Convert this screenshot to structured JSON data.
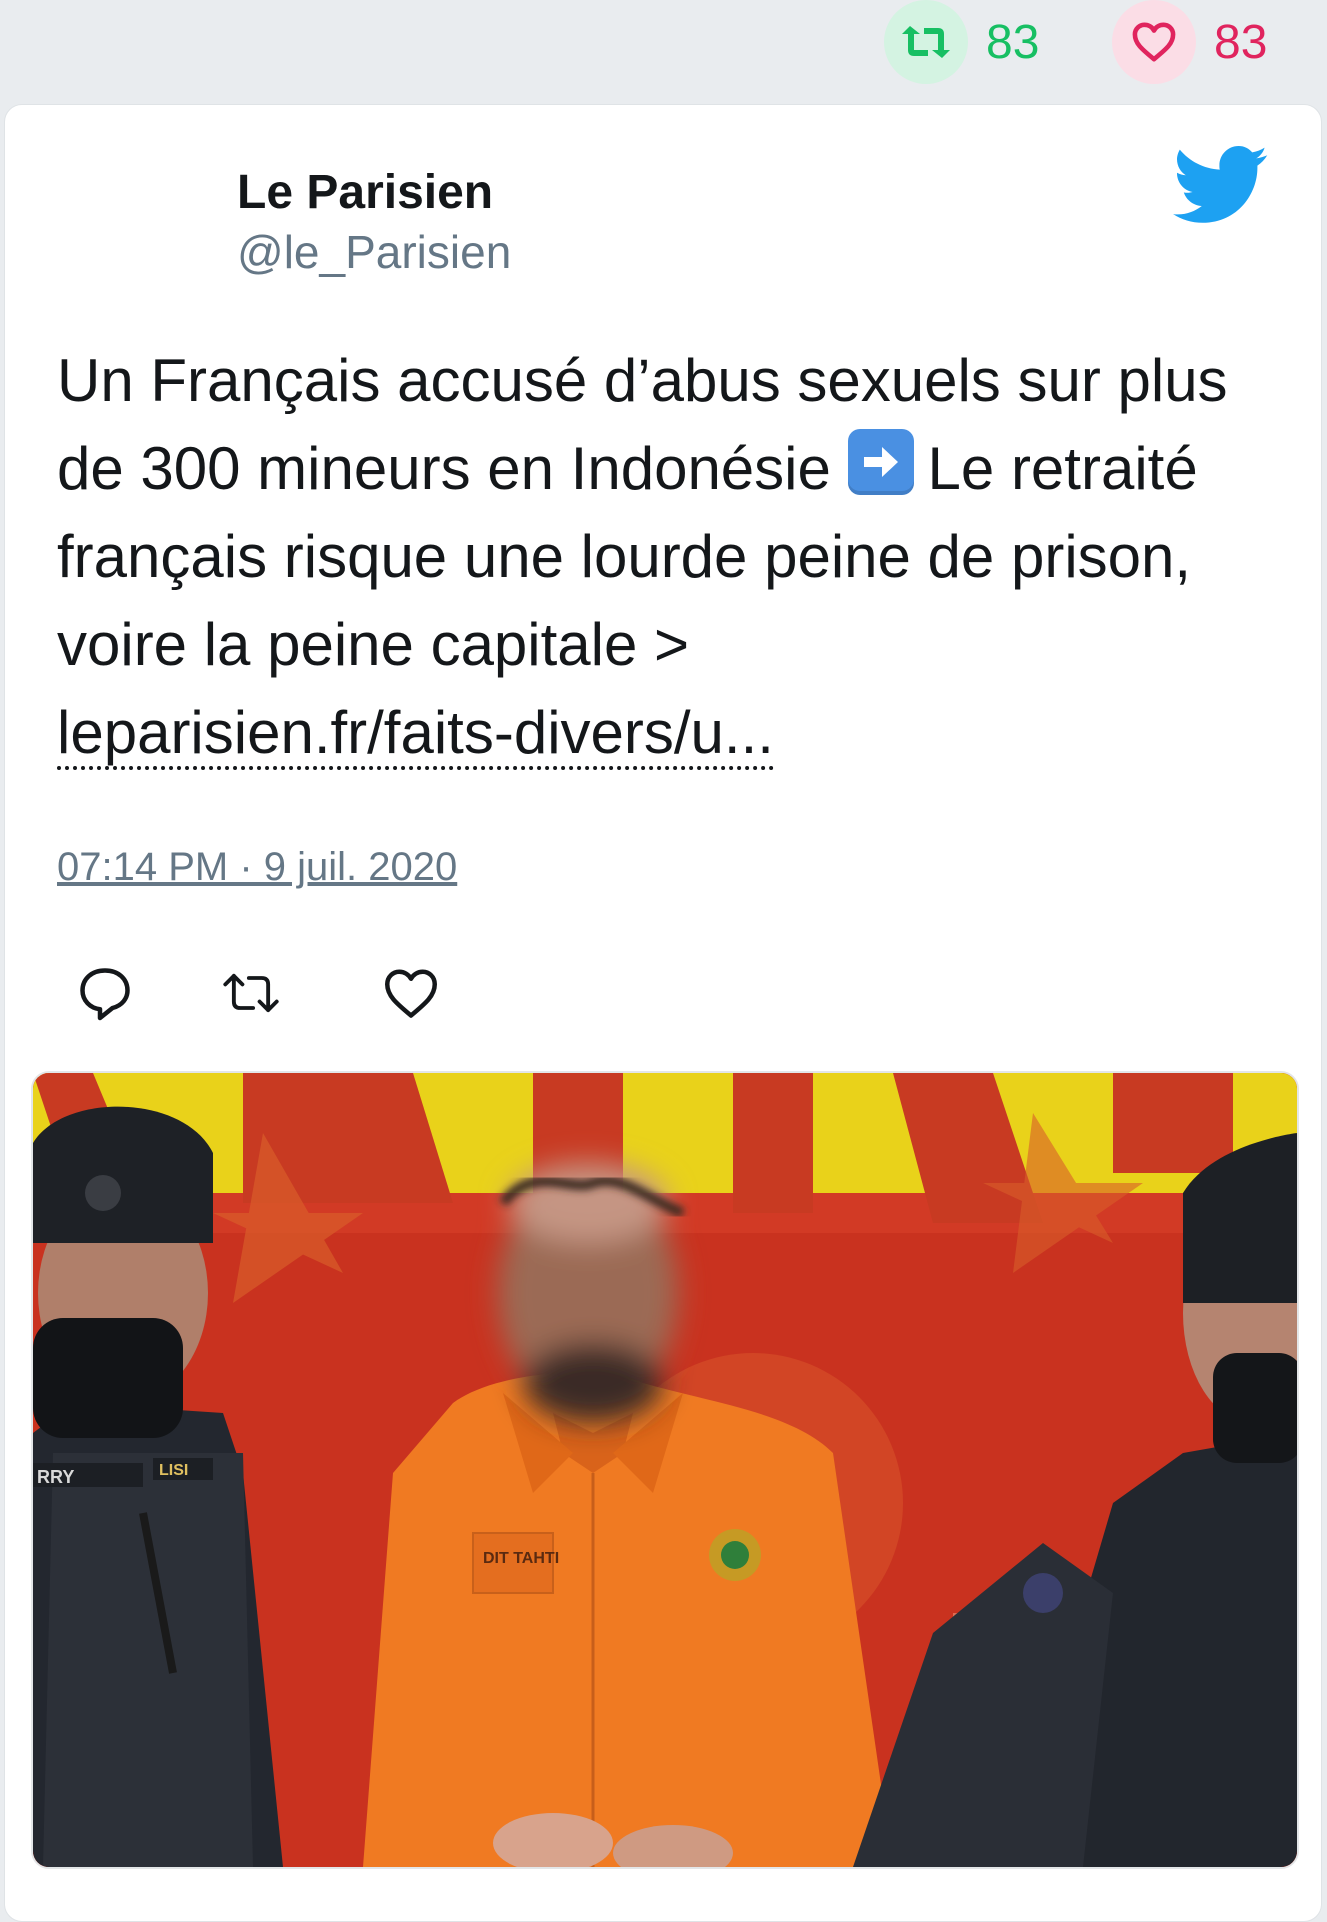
{
  "stats": {
    "retweets": "83",
    "likes": "83",
    "retweet_icon": "retweet-icon",
    "like_icon": "heart-icon",
    "retweet_color": "#17bf63",
    "like_color": "#e0245e"
  },
  "tweet": {
    "author_name": "Le Parisien",
    "author_handle": "@le_Parisien",
    "text_part1": "Un Français accusé d’abus sexuels sur plus de 300 mineurs en Indonésie ",
    "text_part2": "Le retraité français risque une lourde peine de prison, voire la peine capitale > ",
    "link_text": "leparisien.fr/faits-divers/u...",
    "timestamp": "07:14 PM · 9 juil. 2020",
    "brand_icon": "twitter-bird-icon",
    "accent_color": "#1da1f2"
  },
  "actions": [
    "reply-icon",
    "retweet-icon",
    "like-icon"
  ],
  "photo": {
    "label_left_vest": "RRY",
    "label_left_patch": "LISI",
    "label_shirt": "DIT TAHTI"
  }
}
